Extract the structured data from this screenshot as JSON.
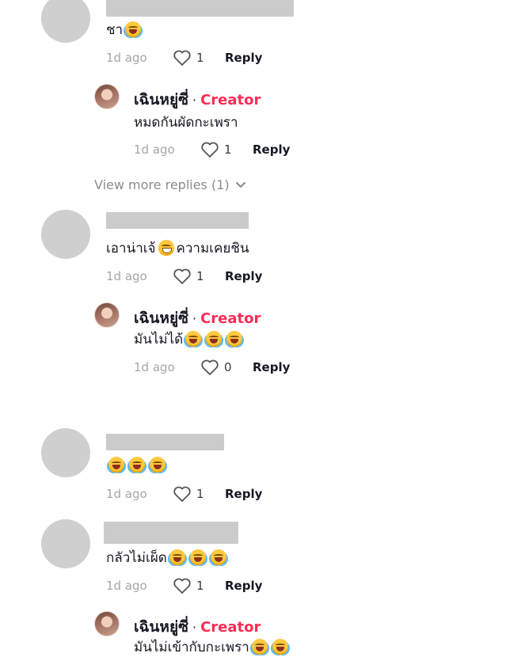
{
  "comments": [
    {
      "text": "ชา",
      "emoji": [
        "face-with-tears-of-joy"
      ],
      "time": "1d ago",
      "likes": "1",
      "reply_label": "Reply"
    },
    {
      "text_before": "เอาน่าเจ้",
      "emoji": [
        "grinning-face"
      ],
      "text_after": "ความเคยชิน",
      "time": "1d ago",
      "likes": "1",
      "reply_label": "Reply"
    },
    {
      "text": "",
      "emoji": [
        "face-with-tears-of-joy",
        "face-with-tears-of-joy",
        "face-with-tears-of-joy"
      ],
      "time": "1d ago",
      "likes": "1",
      "reply_label": "Reply"
    },
    {
      "text": "กลัวไม่เผ็ด",
      "emoji": [
        "face-with-tears-of-joy",
        "face-with-tears-of-joy",
        "face-with-tears-of-joy"
      ],
      "time": "1d ago",
      "likes": "1",
      "reply_label": "Reply"
    }
  ],
  "replies": [
    {
      "author": "เฉินหยู่ซี่",
      "separator": "·",
      "badge": "Creator",
      "text": "หมดกันผัดกะเพรา",
      "time": "1d ago",
      "likes": "1",
      "reply_label": "Reply"
    },
    {
      "author": "เฉินหยู่ซี่",
      "separator": "·",
      "badge": "Creator",
      "text": "มันไม่ได้",
      "emoji": [
        "face-with-tears-of-joy",
        "face-with-tears-of-joy",
        "face-with-tears-of-joy"
      ],
      "time": "1d ago",
      "likes": "0",
      "reply_label": "Reply"
    },
    {
      "author": "เฉินหยู่ซี่",
      "separator": "·",
      "badge": "Creator",
      "text": "มันไม่เข้ากับกะเพรา",
      "emoji": [
        "face-with-tears-of-joy",
        "face-with-tears-of-joy"
      ]
    }
  ],
  "view_more": {
    "label": "View more replies (1)",
    "icon": "chevron-down-icon"
  },
  "colors": {
    "creator_badge": "#fe2c55",
    "placeholder": "#cbcbcb",
    "timestamp": "#a6a6a6"
  }
}
